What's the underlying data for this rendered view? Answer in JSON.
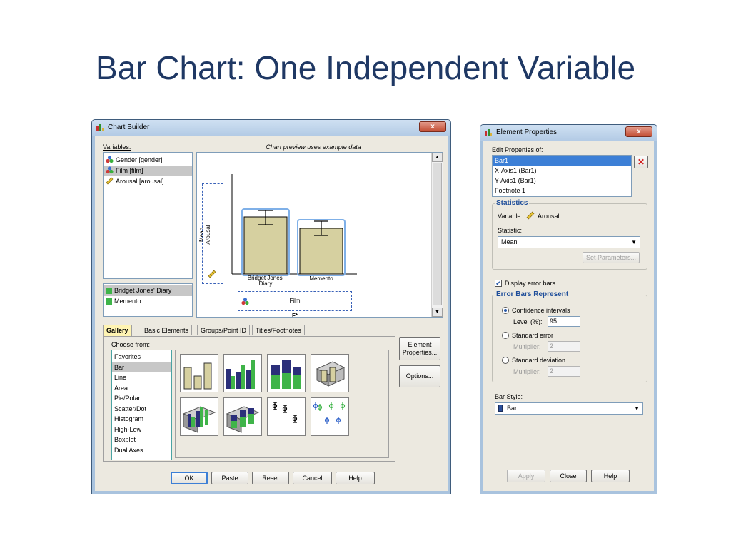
{
  "slide": {
    "title": "Bar Chart: One Independent Variable"
  },
  "chart_builder": {
    "window_title": "Chart Builder",
    "close_glyph": "x",
    "variables_label": "Variables:",
    "variables": [
      {
        "label": "Gender [gender]",
        "icon": "nominal-icon"
      },
      {
        "label": "Film [film]",
        "icon": "nominal-icon",
        "selected": true
      },
      {
        "label": "Arousal [arousal]",
        "icon": "scale-ruler-icon"
      }
    ],
    "categories": [
      "Bridget Jones' Diary",
      "Memento"
    ],
    "preview_caption": "Chart preview uses example data",
    "preview": {
      "y_axis_label_line1": "Mean",
      "y_axis_label_line2": "Arousal",
      "x_drop_label": "Film",
      "x_category_1_line1": "Bridget Jones'",
      "x_category_1_line2": "Diary",
      "x_category_2": "Memento",
      "cut_text": "F*"
    },
    "tabs": [
      "Gallery",
      "Basic Elements",
      "Groups/Point ID",
      "Titles/Footnotes"
    ],
    "active_tab": "Gallery",
    "choose_from_label": "Choose from:",
    "choose_from": [
      "Favorites",
      "Bar",
      "Line",
      "Area",
      "Pie/Polar",
      "Scatter/Dot",
      "Histogram",
      "High-Low",
      "Boxplot",
      "Dual Axes"
    ],
    "selected_choice": "Bar",
    "side_buttons": {
      "element_properties": "Element Properties...",
      "options": "Options..."
    },
    "bottom_buttons": [
      "OK",
      "Paste",
      "Reset",
      "Cancel",
      "Help"
    ],
    "colors": {
      "bar_fill": "#d6d0a0",
      "bar_dark": "#2b2f7a",
      "bar_green": "#3fb449",
      "selection_blue": "#3c7fd6"
    }
  },
  "element_properties": {
    "window_title": "Element Properties",
    "close_glyph": "x",
    "edit_label": "Edit Properties of:",
    "elements": [
      "Bar1",
      "X-Axis1 (Bar1)",
      "Y-Axis1 (Bar1)",
      "Footnote 1"
    ],
    "selected_element": "Bar1",
    "delete_glyph": "✕",
    "statistics_title": "Statistics",
    "variable_label": "Variable:",
    "variable_value": "Arousal",
    "statistic_label": "Statistic:",
    "statistic_value": "Mean",
    "set_parameters": "Set Parameters...",
    "display_error_bars": "Display error bars",
    "display_error_bars_checked": true,
    "error_bars_title": "Error Bars Represent",
    "confidence_intervals": "Confidence intervals",
    "level_label": "Level (%):",
    "level_value": "95",
    "standard_error": "Standard error",
    "multiplier_label": "Multiplier:",
    "multiplier_value_se": "2",
    "standard_deviation": "Standard deviation",
    "multiplier_value_sd": "2",
    "bar_style_label": "Bar Style:",
    "bar_style_value": "Bar",
    "buttons": [
      "Apply",
      "Close",
      "Help"
    ]
  }
}
